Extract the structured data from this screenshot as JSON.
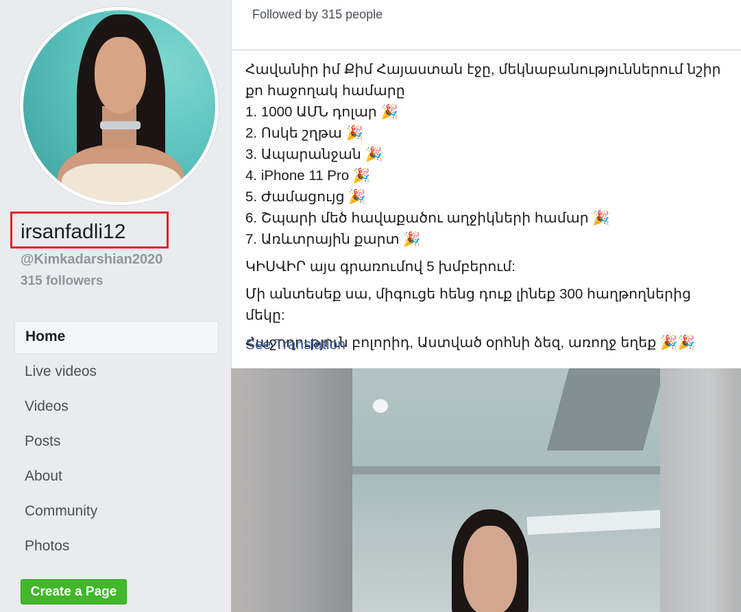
{
  "sidebar": {
    "name": "irsanfadli12",
    "handle": "@Kimkadarshian2020",
    "followers": "315 followers",
    "nav": [
      "Home",
      "Live videos",
      "Videos",
      "Posts",
      "About",
      "Community",
      "Photos"
    ],
    "create_page": "Create a Page"
  },
  "about_card": {
    "followed_by": "Followed by 315 people"
  },
  "post": {
    "lines": [
      "Հավանիր իմ Քիմ Հայաստան էջը, մեկնաբանություններում նշիր քո հաջողակ համարը",
      "1. 1000 ԱՄՆ դոլար 🎉",
      "2. Ոսկե շղթա 🎉",
      "3. Ապարանջան 🎉",
      "4. iPhone 11 Pro 🎉",
      "5. Ժամացույց 🎉",
      "6. Շպարի մեծ հավաքածու աղջիկների համար 🎉",
      "7. Առևտրային քարտ 🎉"
    ],
    "share_line": "ԿԻՍՎԻՐ այս գրառումով 5 խմբերում:",
    "reminder_line": "Մի անտեսեք սա, միգուցե հենց դուք լինեք 300 հաղթողներից մեկը:",
    "closing_line": "Հաջողություն բոլորիդ, Աստված օրհնի ձեզ, առողջ եղեք 🎉🎉",
    "see_translation": "See Translation"
  }
}
